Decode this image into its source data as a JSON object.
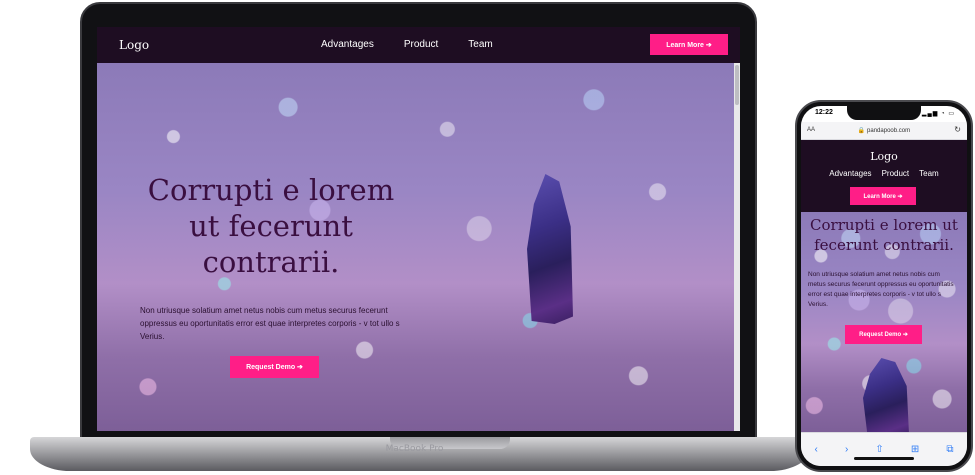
{
  "site": {
    "logo": "Logo",
    "nav_links": [
      "Advantages",
      "Product",
      "Team"
    ],
    "cta_label": "Learn More ➔",
    "hero_heading": "Corrupti e lorem ut fecerunt contrarii.",
    "hero_body": "Non utriusque solatium amet netus nobis cum metus securus fecerunt oppressus eu oportunitatis error est quae interpretes corporis - v tot ullo s Verius.",
    "demo_label": "Request Demo ➔"
  },
  "laptop": {
    "brand": "MacBook Pro"
  },
  "phone": {
    "time": "12:22",
    "status_icons": "▂▄▆ ◔ ▭",
    "aa": "AA",
    "url": "🔒 pandapoob.com",
    "reload": "↻",
    "toolbar": {
      "back": "‹",
      "forward": "›",
      "share": "⇧",
      "bookmarks": "⊞",
      "tabs": "⧉"
    }
  },
  "colors": {
    "accent": "#ff1e87",
    "nav_bg": "#1e0d22",
    "heading": "#3a0f40"
  },
  "icons": [
    "arrow-right-icon",
    "lock-icon",
    "reload-icon",
    "back-icon",
    "forward-icon",
    "share-icon",
    "bookmarks-icon",
    "tabs-icon"
  ]
}
